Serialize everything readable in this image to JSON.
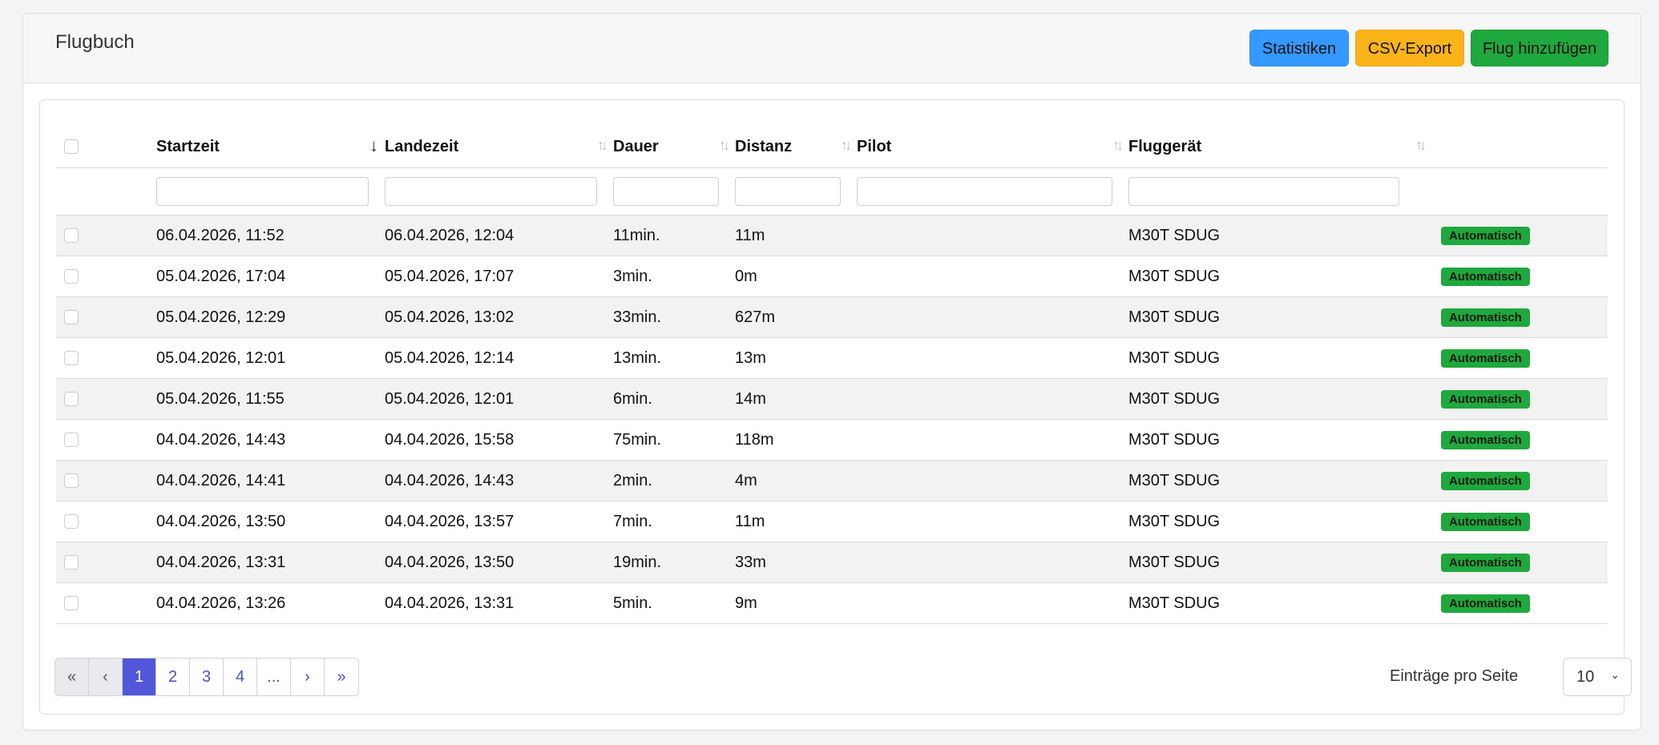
{
  "header": {
    "title": "Flugbuch",
    "buttons": {
      "stats": "Statistiken",
      "csv": "CSV-Export",
      "add": "Flug hinzufügen"
    }
  },
  "table": {
    "columns": {
      "start": "Startzeit",
      "land": "Landezeit",
      "duration": "Dauer",
      "distance": "Distanz",
      "pilot": "Pilot",
      "aircraft": "Fluggerät"
    },
    "sort_active_icon": "↓",
    "sort_icon": "↑↓",
    "rows": [
      {
        "start": "06.04.2026, 11:52",
        "land": "06.04.2026, 12:04",
        "duration": "11min.",
        "distance": "11m",
        "pilot": "",
        "aircraft": "M30T SDUG",
        "badge": "Automatisch"
      },
      {
        "start": "05.04.2026, 17:04",
        "land": "05.04.2026, 17:07",
        "duration": "3min.",
        "distance": "0m",
        "pilot": "",
        "aircraft": "M30T SDUG",
        "badge": "Automatisch"
      },
      {
        "start": "05.04.2026, 12:29",
        "land": "05.04.2026, 13:02",
        "duration": "33min.",
        "distance": "627m",
        "pilot": "",
        "aircraft": "M30T SDUG",
        "badge": "Automatisch"
      },
      {
        "start": "05.04.2026, 12:01",
        "land": "05.04.2026, 12:14",
        "duration": "13min.",
        "distance": "13m",
        "pilot": "",
        "aircraft": "M30T SDUG",
        "badge": "Automatisch"
      },
      {
        "start": "05.04.2026, 11:55",
        "land": "05.04.2026, 12:01",
        "duration": "6min.",
        "distance": "14m",
        "pilot": "",
        "aircraft": "M30T SDUG",
        "badge": "Automatisch"
      },
      {
        "start": "04.04.2026, 14:43",
        "land": "04.04.2026, 15:58",
        "duration": "75min.",
        "distance": "118m",
        "pilot": "",
        "aircraft": "M30T SDUG",
        "badge": "Automatisch"
      },
      {
        "start": "04.04.2026, 14:41",
        "land": "04.04.2026, 14:43",
        "duration": "2min.",
        "distance": "4m",
        "pilot": "",
        "aircraft": "M30T SDUG",
        "badge": "Automatisch"
      },
      {
        "start": "04.04.2026, 13:50",
        "land": "04.04.2026, 13:57",
        "duration": "7min.",
        "distance": "11m",
        "pilot": "",
        "aircraft": "M30T SDUG",
        "badge": "Automatisch"
      },
      {
        "start": "04.04.2026, 13:31",
        "land": "04.04.2026, 13:50",
        "duration": "19min.",
        "distance": "33m",
        "pilot": "",
        "aircraft": "M30T SDUG",
        "badge": "Automatisch"
      },
      {
        "start": "04.04.2026, 13:26",
        "land": "04.04.2026, 13:31",
        "duration": "5min.",
        "distance": "9m",
        "pilot": "",
        "aircraft": "M30T SDUG",
        "badge": "Automatisch"
      }
    ]
  },
  "pagination": {
    "first": "«",
    "prev": "‹",
    "pages": [
      "1",
      "2",
      "3",
      "4",
      "..."
    ],
    "next": "›",
    "last": "»"
  },
  "per_page": {
    "label": "Einträge pro Seite",
    "value": "10"
  }
}
